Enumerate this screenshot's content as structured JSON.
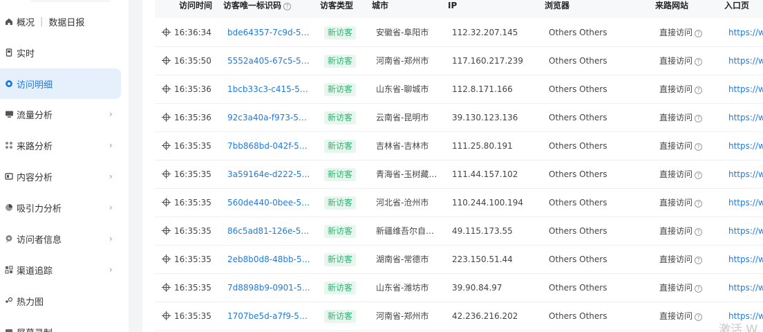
{
  "sidebar": {
    "overview": "概况",
    "daily_report": "数据日报",
    "items": [
      {
        "label": "实时",
        "icon": "realtime-icon",
        "has_chevron": false
      },
      {
        "label": "访问明细",
        "icon": "visit-detail-icon",
        "has_chevron": false,
        "active": true
      },
      {
        "label": "流量分析",
        "icon": "monitor-icon",
        "has_chevron": true
      },
      {
        "label": "来路分析",
        "icon": "source-grid-icon",
        "has_chevron": true
      },
      {
        "label": "内容分析",
        "icon": "content-icon",
        "has_chevron": true
      },
      {
        "label": "吸引力分析",
        "icon": "pie-icon",
        "has_chevron": true
      },
      {
        "label": "访问者信息",
        "icon": "user-chat-icon",
        "has_chevron": true
      },
      {
        "label": "渠道追踪",
        "icon": "channel-icon",
        "has_chevron": true
      },
      {
        "label": "热力图",
        "icon": "heatmap-icon",
        "has_chevron": false
      },
      {
        "label": "屏幕录制",
        "icon": "record-icon",
        "has_chevron": false
      }
    ]
  },
  "table": {
    "headers": {
      "time": "访问时间",
      "visitor_id": "访客唯一标识码",
      "visitor_type": "访客类型",
      "city": "城市",
      "ip": "IP",
      "browser": "浏览器",
      "source": "来路网站",
      "entry": "入口页"
    },
    "rows": [
      {
        "time": "16:36:34",
        "id": "bde64357-7c9d-5a8…",
        "type": "新访客",
        "city": "安徽省-阜阳市",
        "ip": "112.32.207.145",
        "browser": "Others Others",
        "source": "直接访问",
        "entry": "https://w…"
      },
      {
        "time": "16:35:50",
        "id": "5552a405-67c5-576…",
        "type": "新访客",
        "city": "河南省-郑州市",
        "ip": "117.160.217.239",
        "browser": "Others Others",
        "source": "直接访问",
        "entry": "https://w…"
      },
      {
        "time": "16:35:36",
        "id": "1bcb33c3-c415-5a4…",
        "type": "新访客",
        "city": "山东省-聊城市",
        "ip": "112.8.171.166",
        "browser": "Others Others",
        "source": "直接访问",
        "entry": "https://w…"
      },
      {
        "time": "16:35:36",
        "id": "92c3a40a-f973-58e…",
        "type": "新访客",
        "city": "云南省-昆明市",
        "ip": "39.130.123.136",
        "browser": "Others Others",
        "source": "直接访问",
        "entry": "https://w…"
      },
      {
        "time": "16:35:35",
        "id": "7bb868bd-042f-53a…",
        "type": "新访客",
        "city": "吉林省-吉林市",
        "ip": "111.25.80.191",
        "browser": "Others Others",
        "source": "直接访问",
        "entry": "https://w…"
      },
      {
        "time": "16:35:35",
        "id": "3a59164e-d222-5e…",
        "type": "新访客",
        "city": "青海省-玉树藏…",
        "ip": "111.44.157.102",
        "browser": "Others Others",
        "source": "直接访问",
        "entry": "https://w…"
      },
      {
        "time": "16:35:35",
        "id": "560de440-0bee-5d…",
        "type": "新访客",
        "city": "河北省-沧州市",
        "ip": "110.244.100.194",
        "browser": "Others Others",
        "source": "直接访问",
        "entry": "https://w…"
      },
      {
        "time": "16:35:35",
        "id": "86c5ad81-126e-5d7…",
        "type": "新访客",
        "city": "新疆维吾尔自…",
        "ip": "49.115.173.55",
        "browser": "Others Others",
        "source": "直接访问",
        "entry": "https://w…"
      },
      {
        "time": "16:35:35",
        "id": "2eb8b0d8-48bb-5e…",
        "type": "新访客",
        "city": "湖南省-常德市",
        "ip": "223.150.51.44",
        "browser": "Others Others",
        "source": "直接访问",
        "entry": "https://w…"
      },
      {
        "time": "16:35:35",
        "id": "7d8898b9-0901-59…",
        "type": "新访客",
        "city": "山东省-潍坊市",
        "ip": "39.90.84.97",
        "browser": "Others Others",
        "source": "直接访问",
        "entry": "https://w…"
      },
      {
        "time": "16:35:35",
        "id": "1707be5d-a7f9-535…",
        "type": "新访客",
        "city": "河南省-郑州市",
        "ip": "42.236.216.202",
        "browser": "Others Others",
        "source": "直接访问",
        "entry": "https://w…"
      }
    ]
  },
  "watermark": "激活 W",
  "colors": {
    "accent": "#1f7ae0",
    "active_bg": "#e6f0fd",
    "new_visitor_bg": "#e7f7ee",
    "new_visitor_text": "#2bb673"
  }
}
